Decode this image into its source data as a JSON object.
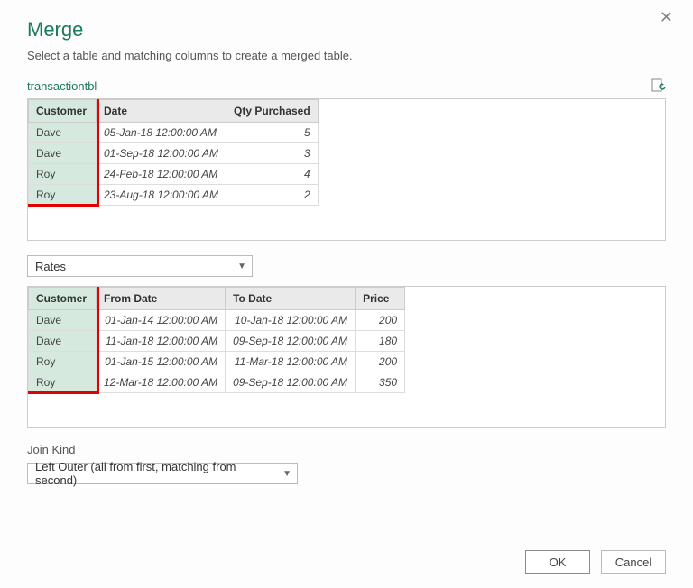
{
  "dialog": {
    "title": "Merge",
    "subtitle": "Select a table and matching columns to create a merged table.",
    "close_char": "✕"
  },
  "table1": {
    "name": "transactiontbl",
    "columns": [
      "Customer",
      "Date",
      "Qty Purchased"
    ],
    "rows": [
      [
        "Dave",
        "05-Jan-18 12:00:00 AM",
        "5"
      ],
      [
        "Dave",
        "01-Sep-18 12:00:00 AM",
        "3"
      ],
      [
        "Roy",
        "24-Feb-18 12:00:00 AM",
        "4"
      ],
      [
        "Roy",
        "23-Aug-18 12:00:00 AM",
        "2"
      ]
    ]
  },
  "table2_selector": {
    "value": "Rates"
  },
  "table2": {
    "columns": [
      "Customer",
      "From Date",
      "To Date",
      "Price"
    ],
    "rows": [
      [
        "Dave",
        "01-Jan-14 12:00:00 AM",
        "10-Jan-18 12:00:00 AM",
        "200"
      ],
      [
        "Dave",
        "11-Jan-18 12:00:00 AM",
        "09-Sep-18 12:00:00 AM",
        "180"
      ],
      [
        "Roy",
        "01-Jan-15 12:00:00 AM",
        "11-Mar-18 12:00:00 AM",
        "200"
      ],
      [
        "Roy",
        "12-Mar-18 12:00:00 AM",
        "09-Sep-18 12:00:00 AM",
        "350"
      ]
    ]
  },
  "join": {
    "label": "Join Kind",
    "value": "Left Outer (all from first, matching from second)"
  },
  "buttons": {
    "ok": "OK",
    "cancel": "Cancel"
  },
  "chart_data": {
    "type": "table",
    "tables": [
      {
        "name": "transactiontbl",
        "columns": [
          "Customer",
          "Date",
          "Qty Purchased"
        ],
        "rows": [
          [
            "Dave",
            "05-Jan-18 12:00:00 AM",
            5
          ],
          [
            "Dave",
            "01-Sep-18 12:00:00 AM",
            3
          ],
          [
            "Roy",
            "24-Feb-18 12:00:00 AM",
            4
          ],
          [
            "Roy",
            "23-Aug-18 12:00:00 AM",
            2
          ]
        ]
      },
      {
        "name": "Rates",
        "columns": [
          "Customer",
          "From Date",
          "To Date",
          "Price"
        ],
        "rows": [
          [
            "Dave",
            "01-Jan-14 12:00:00 AM",
            "10-Jan-18 12:00:00 AM",
            200
          ],
          [
            "Dave",
            "11-Jan-18 12:00:00 AM",
            "09-Sep-18 12:00:00 AM",
            180
          ],
          [
            "Roy",
            "01-Jan-15 12:00:00 AM",
            "11-Mar-18 12:00:00 AM",
            200
          ],
          [
            "Roy",
            "12-Mar-18 12:00:00 AM",
            "09-Sep-18 12:00:00 AM",
            350
          ]
        ]
      }
    ]
  }
}
